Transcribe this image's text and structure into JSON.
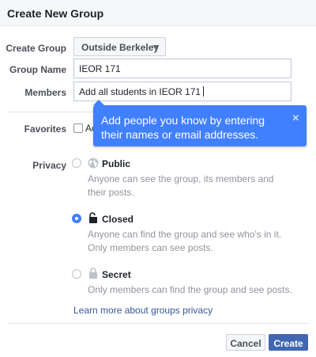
{
  "dialog": {
    "title": "Create New Group"
  },
  "form": {
    "create_group_label": "Create Group",
    "create_group_value": "Outside Berkeley",
    "group_name_label": "Group Name",
    "group_name_value": "IEOR 171",
    "members_label": "Members",
    "members_value": "Add all students in IEOR 171",
    "favorites_label": "Favorites",
    "favorites_checkbox_text": "Ac"
  },
  "tooltip": {
    "text": "Add people you know by entering their names or email addresses.",
    "close_glyph": "×"
  },
  "privacy": {
    "label": "Privacy",
    "selected": "closed",
    "options": [
      {
        "id": "public",
        "title": "Public",
        "icon": "globe-icon",
        "desc": "Anyone can see the group, its members and their posts."
      },
      {
        "id": "closed",
        "title": "Closed",
        "icon": "unlock-icon",
        "desc": "Anyone can find the group and see who's in it. Only members can see posts."
      },
      {
        "id": "secret",
        "title": "Secret",
        "icon": "lock-icon",
        "desc": "Only members can find the group and see posts."
      }
    ],
    "learn_more": "Learn more about groups privacy"
  },
  "footer": {
    "cancel_label": "Cancel",
    "create_label": "Create"
  },
  "colors": {
    "accent": "#4080ff",
    "primary_button": "#4267b2",
    "link": "#365899"
  }
}
